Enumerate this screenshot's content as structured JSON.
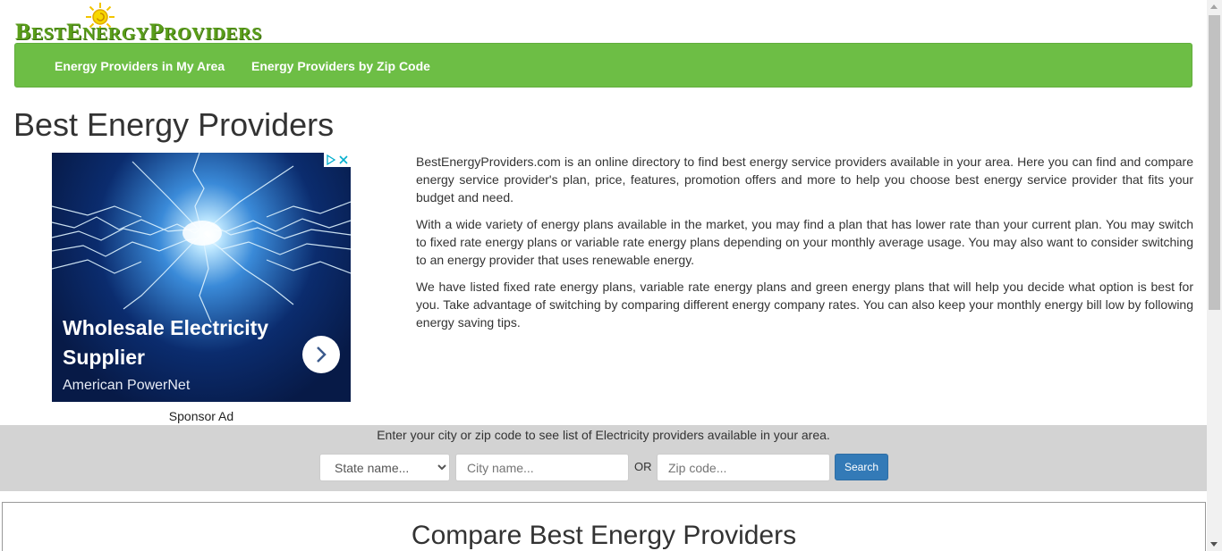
{
  "logo": {
    "text": "BestEnergyProviders"
  },
  "nav": {
    "items": [
      {
        "label": "Energy Providers in My Area"
      },
      {
        "label": "Energy Providers by Zip Code"
      }
    ]
  },
  "page_title": "Best Energy Providers",
  "ad": {
    "title": "Wholesale Electricity Supplier",
    "brand": "American PowerNet",
    "sponsor_label": "Sponsor Ad"
  },
  "description": [
    "BestEnergyProviders.com is an online directory to find best energy service providers available in your area. Here you can find and compare energy service provider's plan, price, features, promotion offers and more to help you choose best energy service provider that fits your budget and need.",
    "With a wide variety of energy plans available in the market, you may find a plan that has lower rate than your current plan. You may switch to fixed rate energy plans or variable rate energy plans depending on your monthly average usage. You may also want to consider switching to an energy provider that uses renewable energy.",
    "We have listed fixed rate energy plans, variable rate energy plans and green energy plans that will help you decide what option is best for you. Take advantage of switching by comparing different energy company rates. You can also keep your monthly energy bill low by following energy saving tips."
  ],
  "search": {
    "hint": "Enter your city or zip code to see list of Electricity providers available in your area.",
    "state_selected": "State name...",
    "city_placeholder": "City name...",
    "or_label": "OR",
    "zip_placeholder": "Zip code...",
    "button_label": "Search"
  },
  "compare": {
    "title": "Compare Best Energy Providers"
  },
  "colors": {
    "nav_green": "#6dbe45",
    "logo_green": "#5a9e1a",
    "search_button": "#337ab7"
  }
}
